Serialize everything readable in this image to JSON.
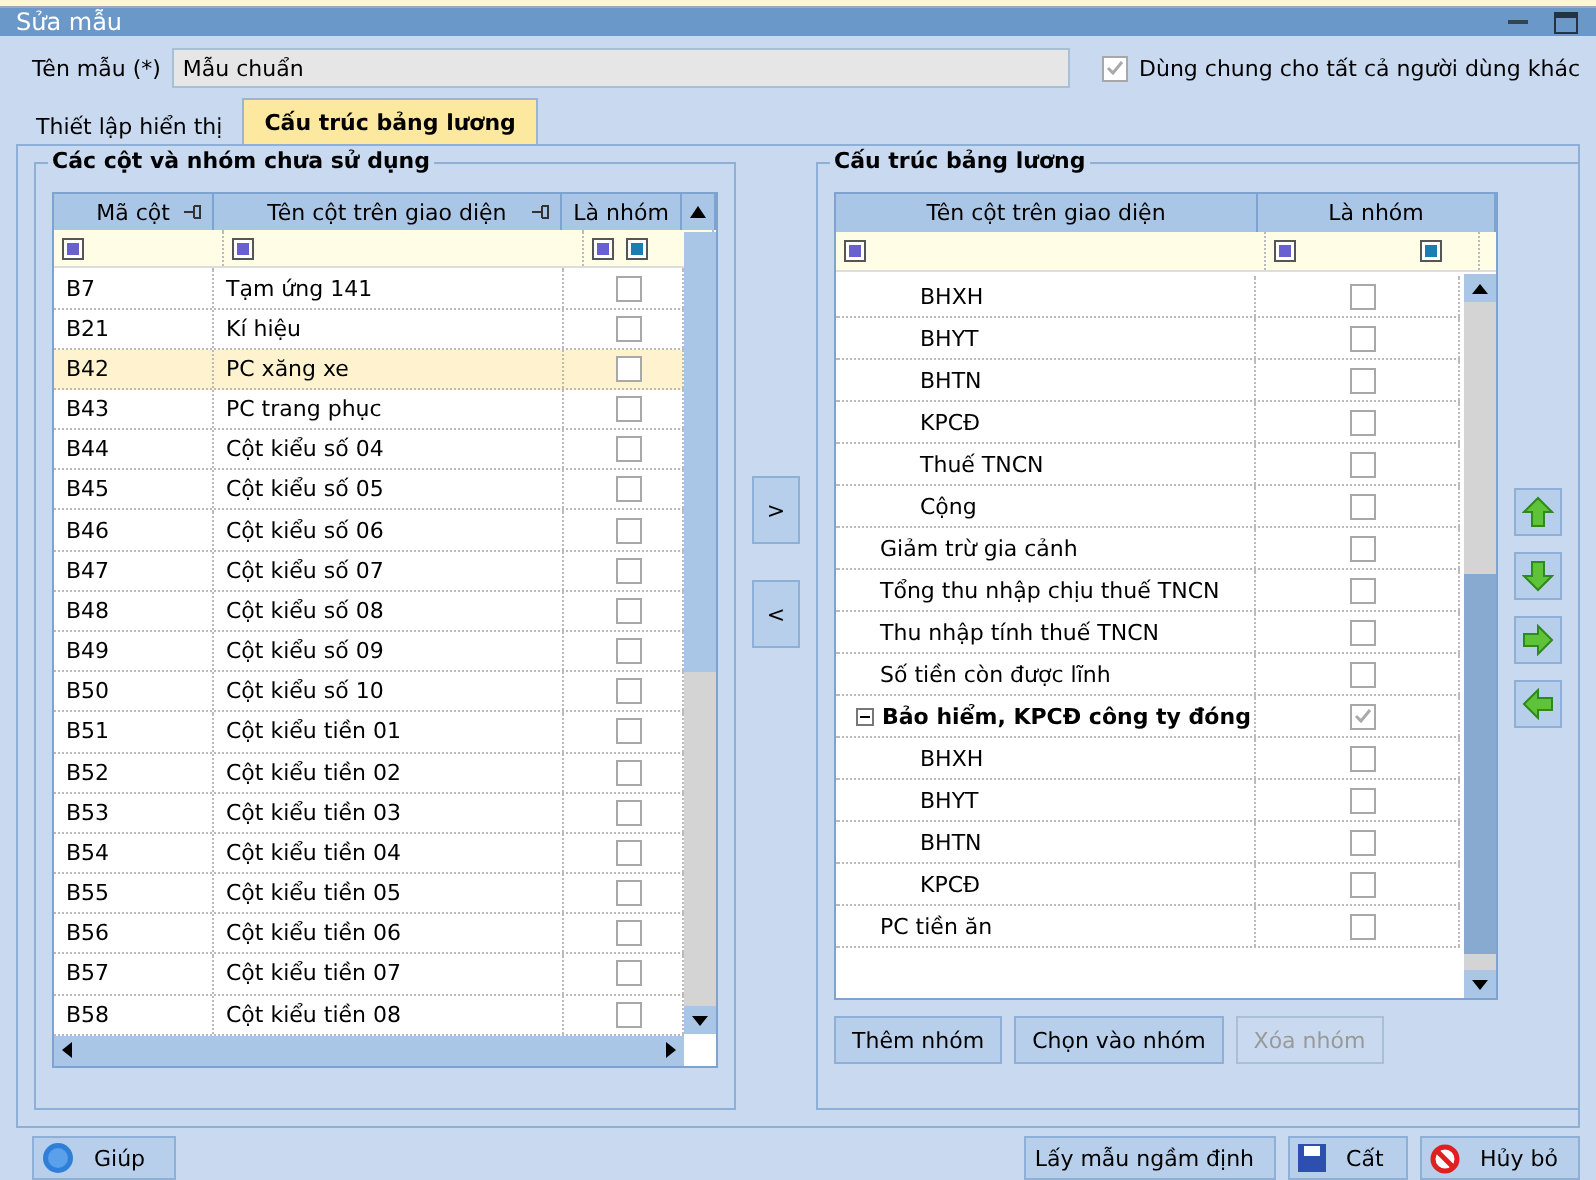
{
  "window": {
    "title": "Sửa mẫu"
  },
  "name_field": {
    "label": "Tên mẫu (*)",
    "value": "Mẫu chuẩn"
  },
  "shared_checkbox": {
    "label": "Dùng chung cho tất cả  người dùng khác",
    "checked": true
  },
  "tabs": [
    {
      "label": "Thiết lập hiển thị",
      "selected": false
    },
    {
      "label": "Cấu trúc bảng lương",
      "selected": true
    }
  ],
  "unused_panel": {
    "title": "Các cột và nhóm chưa sử dụng",
    "columns": [
      "Mã cột",
      "Tên cột trên giao diện",
      "Là nhóm"
    ],
    "rows": [
      {
        "code": "B7",
        "name": "Tạm ứng 141",
        "checked": false,
        "selected": false
      },
      {
        "code": "B21",
        "name": "Kí hiệu",
        "checked": false,
        "selected": false
      },
      {
        "code": "B42",
        "name": "PC xăng xe",
        "checked": false,
        "selected": true
      },
      {
        "code": "B43",
        "name": "PC trang phục",
        "checked": false,
        "selected": false
      },
      {
        "code": "B44",
        "name": "Cột kiểu số 04",
        "checked": false,
        "selected": false
      },
      {
        "code": "B45",
        "name": "Cột kiểu số 05",
        "checked": false,
        "selected": false
      },
      {
        "code": "B46",
        "name": "Cột kiểu số 06",
        "checked": false,
        "selected": false
      },
      {
        "code": "B47",
        "name": "Cột kiểu số 07",
        "checked": false,
        "selected": false
      },
      {
        "code": "B48",
        "name": "Cột kiểu số 08",
        "checked": false,
        "selected": false
      },
      {
        "code": "B49",
        "name": "Cột kiểu số 09",
        "checked": false,
        "selected": false
      },
      {
        "code": "B50",
        "name": "Cột kiểu số 10",
        "checked": false,
        "selected": false
      },
      {
        "code": "B51",
        "name": "Cột kiểu tiền 01",
        "checked": false,
        "selected": false
      },
      {
        "code": "B52",
        "name": "Cột kiểu tiền 02",
        "checked": false,
        "selected": false
      },
      {
        "code": "B53",
        "name": "Cột kiểu tiền 03",
        "checked": false,
        "selected": false
      },
      {
        "code": "B54",
        "name": "Cột kiểu tiền 04",
        "checked": false,
        "selected": false
      },
      {
        "code": "B55",
        "name": "Cột kiểu tiền 05",
        "checked": false,
        "selected": false
      },
      {
        "code": "B56",
        "name": "Cột kiểu tiền 06",
        "checked": false,
        "selected": false
      },
      {
        "code": "B57",
        "name": "Cột kiểu tiền 07",
        "checked": false,
        "selected": false
      },
      {
        "code": "B58",
        "name": "Cột kiểu tiền 08",
        "checked": false,
        "selected": false
      }
    ]
  },
  "move_buttons": [
    ">",
    "<"
  ],
  "structure_panel": {
    "title": "Cấu trúc bảng lương",
    "columns": [
      "Tên cột trên giao diện",
      "Là nhóm"
    ],
    "rows": [
      {
        "children": [
          {
            "name": "BHXH",
            "checked": false
          },
          {
            "name": "BHYT",
            "checked": false
          },
          {
            "name": "BHTN",
            "checked": false
          },
          {
            "name": "KPCĐ",
            "checked": false
          },
          {
            "name": "Thuế TNCN",
            "checked": false
          },
          {
            "name": "Cộng",
            "checked": false
          }
        ]
      },
      {
        "name": "Giảm trừ gia cảnh",
        "checked": false
      },
      {
        "name": "Tổng thu nhập chịu thuế TNCN",
        "checked": false
      },
      {
        "name": "Thu nhập tính thuế TNCN",
        "checked": false
      },
      {
        "name": "Số tiền còn được lĩnh",
        "checked": false
      },
      {
        "name": "Bảo hiểm, KPCĐ công ty đóng",
        "checked": true,
        "expanded": true,
        "children": [
          {
            "name": "BHXH",
            "checked": false
          },
          {
            "name": "BHYT",
            "checked": false
          },
          {
            "name": "BHTN",
            "checked": false
          },
          {
            "name": "KPCĐ",
            "checked": false
          }
        ]
      },
      {
        "name": "PC tiền ăn",
        "checked": false
      }
    ],
    "buttons": [
      {
        "label": "Thêm nhóm",
        "disabled": false
      },
      {
        "label": "Chọn vào nhóm",
        "disabled": false
      },
      {
        "label": "Xóa nhóm",
        "disabled": true
      }
    ]
  },
  "order_buttons": [
    {
      "kind": "up"
    },
    {
      "kind": "down"
    },
    {
      "kind": "right"
    },
    {
      "kind": "left"
    }
  ],
  "footer": {
    "help": "Giúp",
    "buttons": [
      {
        "kind": "plain",
        "label": "Lấy mẫu ngầm định"
      },
      {
        "kind": "save",
        "label": "Cất"
      },
      {
        "kind": "cancel",
        "label": "Hủy bỏ"
      }
    ]
  }
}
